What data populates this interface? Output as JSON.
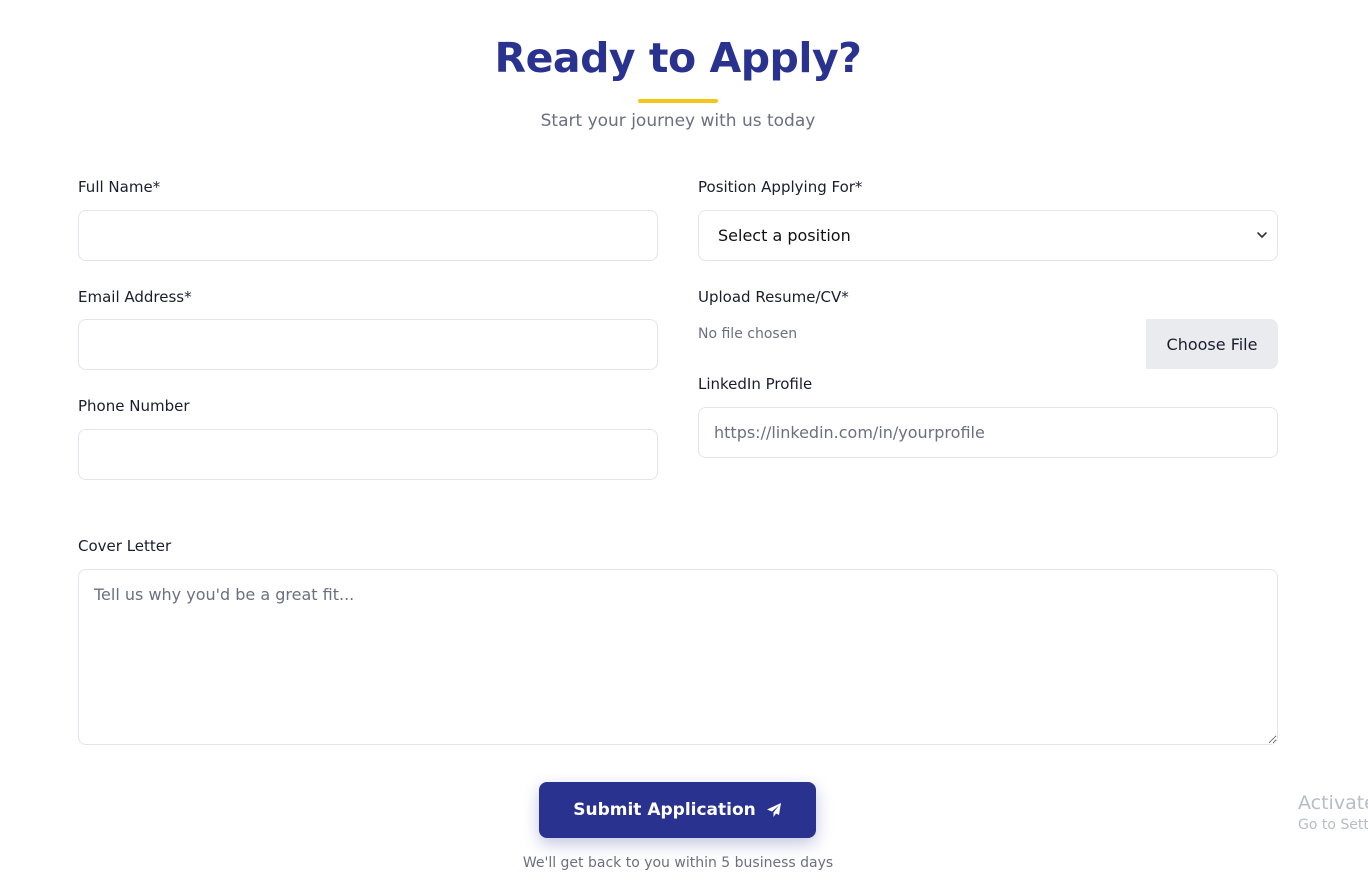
{
  "header": {
    "title": "Ready to Apply?",
    "subtitle": "Start your journey with us today",
    "accent_color": "#f5c518",
    "brand_color": "#2a3290"
  },
  "form": {
    "full_name": {
      "label": "Full Name*",
      "value": ""
    },
    "email": {
      "label": "Email Address*",
      "value": ""
    },
    "phone": {
      "label": "Phone Number",
      "value": ""
    },
    "position": {
      "label": "Position Applying For*",
      "selected": "Select a position"
    },
    "resume": {
      "label": "Upload Resume/CV*",
      "status": "No file chosen",
      "button_label": "Choose File"
    },
    "linkedin": {
      "label": "LinkedIn Profile",
      "placeholder": "https://linkedin.com/in/yourprofile",
      "value": ""
    },
    "cover_letter": {
      "label": "Cover Letter",
      "placeholder": "Tell us why you'd be a great fit...",
      "value": ""
    }
  },
  "submit": {
    "label": "Submit Application",
    "icon": "paper-plane-icon",
    "note": "We'll get back to you within 5 business days"
  },
  "watermark": {
    "title": "Activate",
    "subtitle": "Go to Setti"
  }
}
